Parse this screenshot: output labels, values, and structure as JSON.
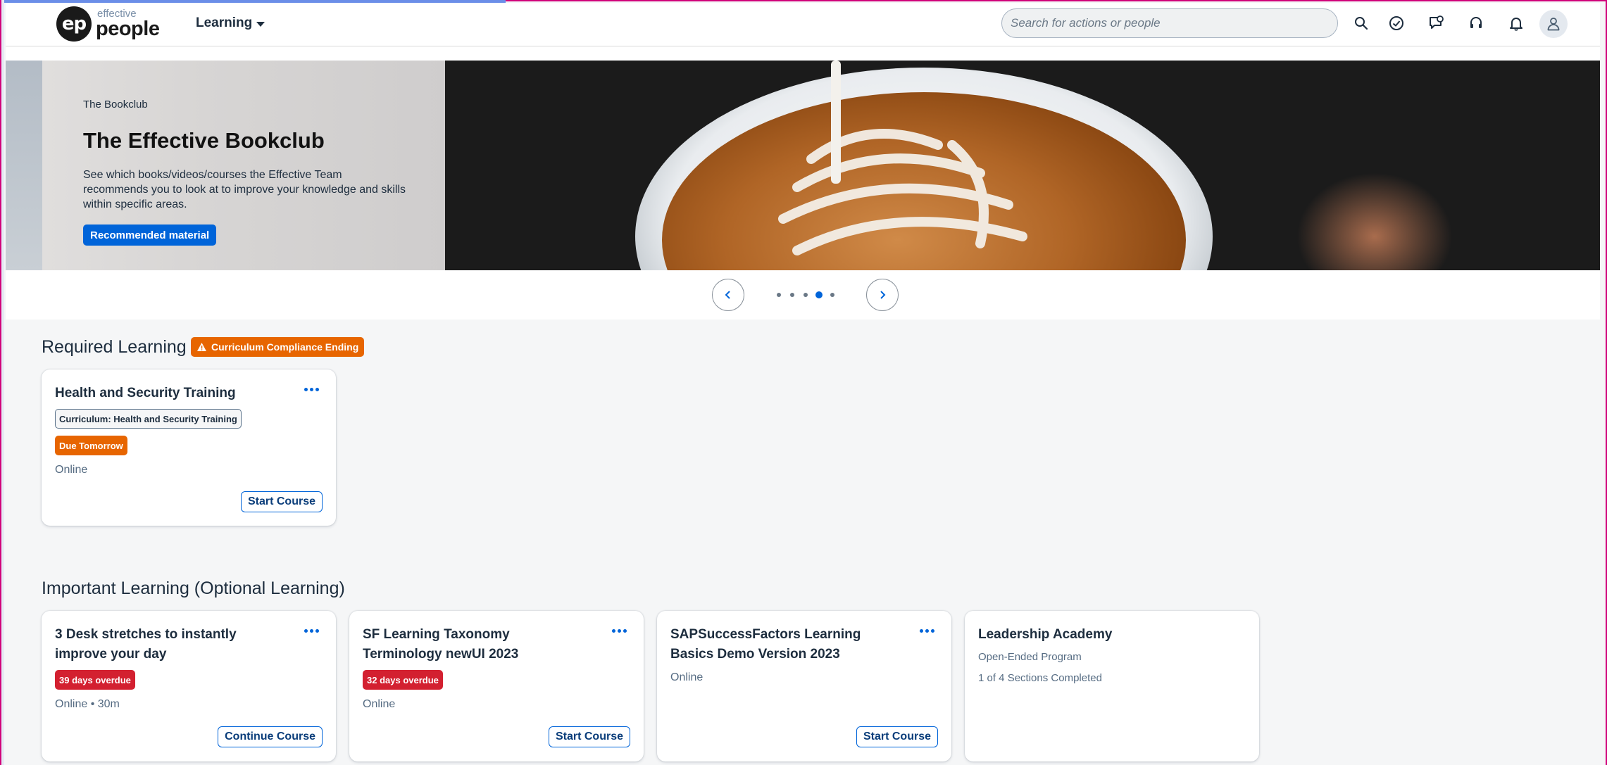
{
  "header": {
    "logo_mark": "ep",
    "logo_small": "effective",
    "logo_big": "people",
    "menu_label": "Learning",
    "search_placeholder": "Search for actions or people",
    "icons": [
      "search-icon",
      "checkmark-icon",
      "chat-icon",
      "headset-icon",
      "bell-icon",
      "user-icon"
    ]
  },
  "hero": {
    "eyebrow": "The Bookclub",
    "title": "The Effective Bookclub",
    "description": "See which books/videos/courses the Effective Team recommends you to look at to improve your knowledge and skills within specific areas.",
    "button_label": "Recommended material",
    "slide_count": 5,
    "active_slide": 4
  },
  "required": {
    "title": "Required Learning",
    "badge": "Curriculum Compliance Ending",
    "cards": [
      {
        "title": "Health and Security Training",
        "curriculum": "Curriculum: Health and Security Training",
        "status": "Due Tomorrow",
        "delivery": "Online",
        "action": "Start Course"
      }
    ]
  },
  "important": {
    "title": "Important Learning (Optional Learning)",
    "cards": [
      {
        "title": "3 Desk stretches to instantly improve your day",
        "status": "39 days overdue",
        "delivery": "Online • 30m",
        "action": "Continue Course"
      },
      {
        "title": "SF Learning Taxonomy Terminology newUI 2023",
        "status": "32 days overdue",
        "delivery": "Online",
        "action": "Start Course"
      },
      {
        "title": "SAPSuccessFactors Learning Basics Demo Version 2023",
        "delivery": "Online",
        "action": "Start Course"
      },
      {
        "title": "Leadership Academy",
        "program": "Open-Ended Program",
        "progress": "1 of 4 Sections Completed"
      }
    ]
  },
  "colors": {
    "accent": "#0064d9",
    "warning": "#e76500",
    "negative": "#d32030",
    "frame": "#d1007a"
  }
}
